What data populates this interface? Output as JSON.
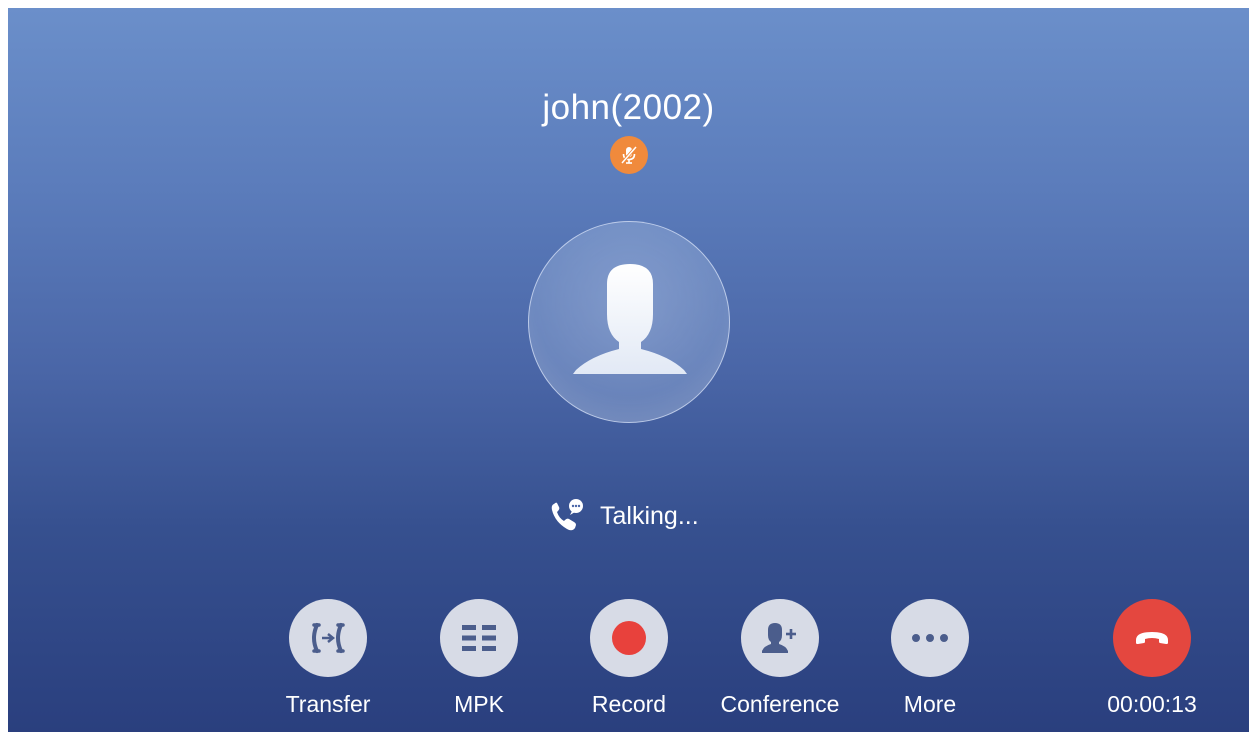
{
  "call": {
    "contact_name": "john(2002)",
    "status_text": "Talking...",
    "duration": "00:00:13"
  },
  "actions": [
    {
      "label": "Transfer",
      "icon": "transfer-icon"
    },
    {
      "label": "MPK",
      "icon": "mpk-grid-icon"
    },
    {
      "label": "Record",
      "icon": "record-dot-icon"
    },
    {
      "label": "Conference",
      "icon": "add-person-icon"
    },
    {
      "label": "More",
      "icon": "more-dots-icon"
    }
  ],
  "hangup": {
    "icon": "hang-up-icon"
  },
  "colors": {
    "background_top": "#6b8fca",
    "background_bottom": "#2a3f7e",
    "mute_badge": "#f08a3c",
    "record_dot": "#e8413c",
    "hangup_button": "#e4473f",
    "action_button": "#d7dbe6",
    "action_icon": "#4b5d8c"
  }
}
